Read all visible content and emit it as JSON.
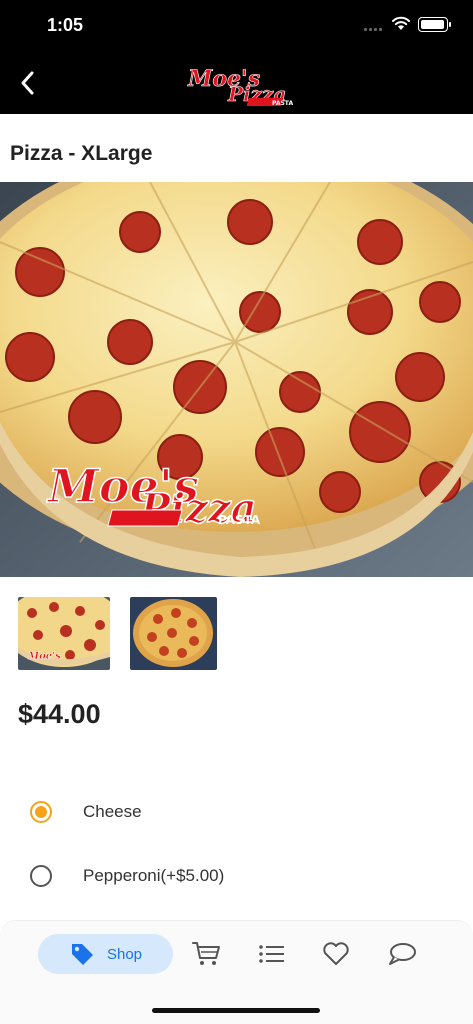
{
  "status_bar": {
    "time": "1:05"
  },
  "header": {
    "logo_text": "Moe's",
    "logo_text_2": "Pizza",
    "logo_text_3": "PASTA"
  },
  "product": {
    "title": "Pizza - XLarge",
    "price": "$44.00",
    "thumbnail_count": 2
  },
  "options": [
    {
      "label": "Cheese",
      "selected": true
    },
    {
      "label": "Pepperoni(+$5.00)",
      "selected": false
    }
  ],
  "tabbar": {
    "shop_label": "Shop",
    "active_color": "#1a73e8",
    "active_bg": "#d6e8fb"
  },
  "colors": {
    "accent": "#f5a31a",
    "brand_red": "#e0141e"
  }
}
